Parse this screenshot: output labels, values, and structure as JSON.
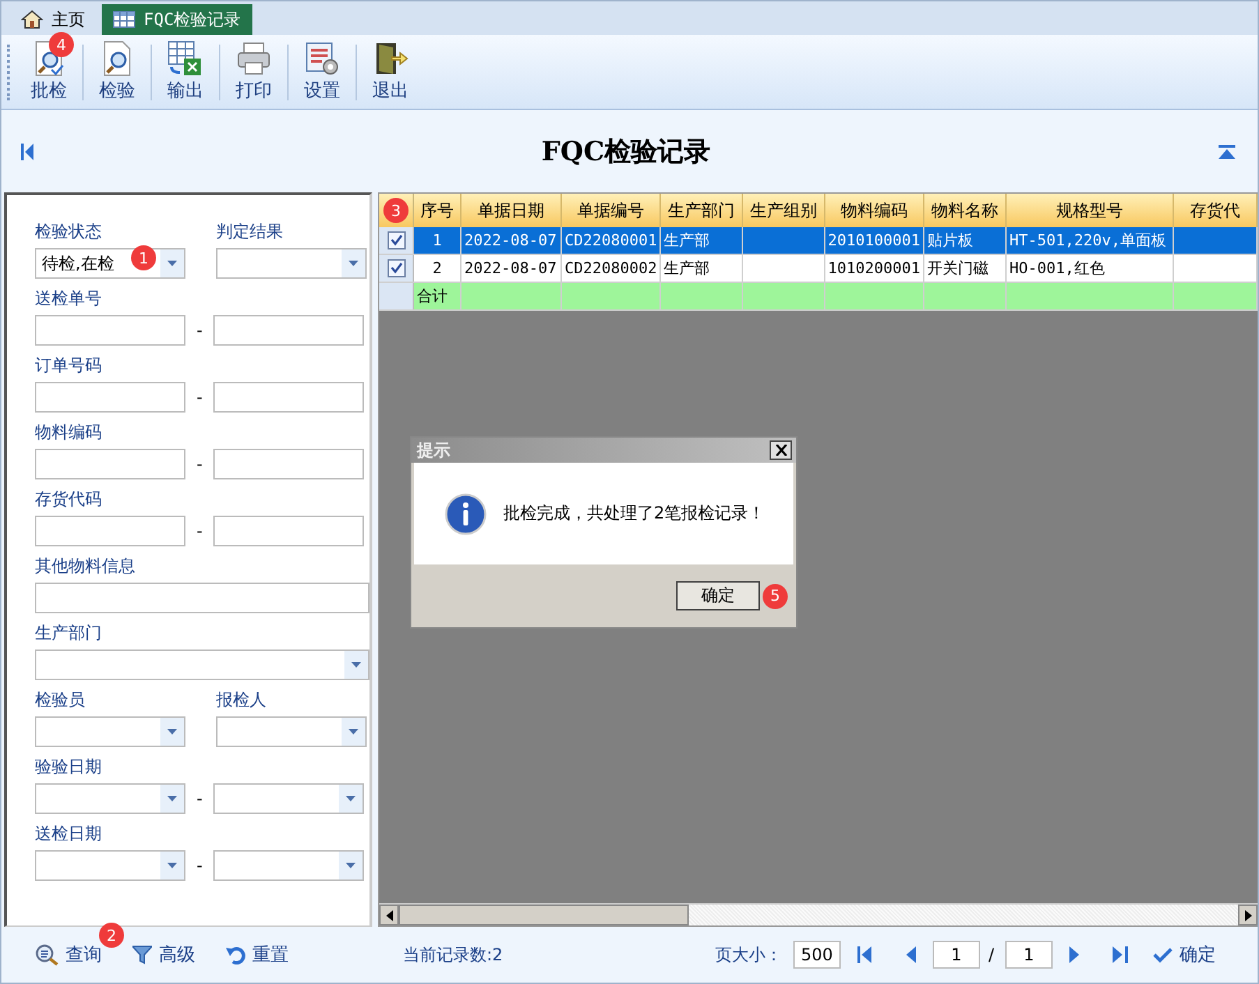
{
  "tabs": [
    {
      "label": "主页",
      "selected": false
    },
    {
      "label": "FQC检验记录",
      "selected": true
    }
  ],
  "toolbar": [
    {
      "label": "批检",
      "badge": "4"
    },
    {
      "label": "检验"
    },
    {
      "label": "输出"
    },
    {
      "label": "打印"
    },
    {
      "label": "设置"
    },
    {
      "label": "退出"
    }
  ],
  "title": "FQC检验记录",
  "filters": [
    {
      "kind": "pair",
      "fields": [
        {
          "label": "检验状态",
          "kind": "combo",
          "value": "待检,在检",
          "badge": "1"
        },
        {
          "label": "判定结果",
          "kind": "combo"
        }
      ]
    },
    {
      "kind": "range",
      "label": "送检单号",
      "separator": "-",
      "fields": [
        {
          "kind": "text"
        },
        {
          "kind": "text"
        }
      ]
    },
    {
      "kind": "range",
      "label": "订单号码",
      "separator": "-",
      "fields": [
        {
          "kind": "text"
        },
        {
          "kind": "text"
        }
      ]
    },
    {
      "kind": "range",
      "label": "物料编码",
      "separator": "-",
      "fields": [
        {
          "kind": "text"
        },
        {
          "kind": "text"
        }
      ]
    },
    {
      "kind": "range",
      "label": "存货代码",
      "separator": "-",
      "fields": [
        {
          "kind": "text"
        },
        {
          "kind": "text"
        }
      ]
    },
    {
      "kind": "single",
      "label": "其他物料信息",
      "fields": [
        {
          "kind": "text"
        }
      ]
    },
    {
      "kind": "single",
      "label": "生产部门",
      "fields": [
        {
          "kind": "combo"
        }
      ]
    },
    {
      "kind": "pair",
      "fields": [
        {
          "label": "检验员",
          "kind": "combo"
        },
        {
          "label": "报检人",
          "kind": "combo"
        }
      ]
    },
    {
      "kind": "range",
      "label": "验验日期",
      "separator": "-",
      "fields": [
        {
          "kind": "combo"
        },
        {
          "kind": "combo"
        }
      ]
    },
    {
      "kind": "range",
      "label": "送检日期",
      "separator": "-",
      "fields": [
        {
          "kind": "combo"
        },
        {
          "kind": "combo"
        }
      ]
    }
  ],
  "filter_actions": [
    {
      "label": "查询",
      "badge": "2"
    },
    {
      "label": "高级"
    },
    {
      "label": "重置"
    }
  ],
  "grid": {
    "corner_badge": "3",
    "columns": [
      "序号",
      "单据日期",
      "单据编号",
      "生产部门",
      "生产组别",
      "物料编码",
      "物料名称",
      "规格型号",
      "存货代"
    ],
    "rows": [
      {
        "checked": true,
        "selected": true,
        "cells": [
          "1",
          "2022-08-07",
          "CD22080001",
          "生产部",
          "",
          "2010100001",
          "贴片板",
          "HT-501,220v,单面板",
          ""
        ]
      },
      {
        "checked": true,
        "selected": false,
        "cells": [
          "2",
          "2022-08-07",
          "CD22080002",
          "生产部",
          "",
          "1010200001",
          "开关门磁",
          "HO-001,红色",
          ""
        ]
      }
    ],
    "total_label": "合计"
  },
  "dialog": {
    "title": "提示",
    "message": "批检完成，共处理了2笔报检记录！",
    "ok": "确定",
    "ok_badge": "5"
  },
  "status": {
    "record_count": "当前记录数:2",
    "page_size_label": "页大小：",
    "page_size": "500",
    "page": "1",
    "page_separator": "/",
    "pages": "1",
    "confirm": "确定"
  }
}
